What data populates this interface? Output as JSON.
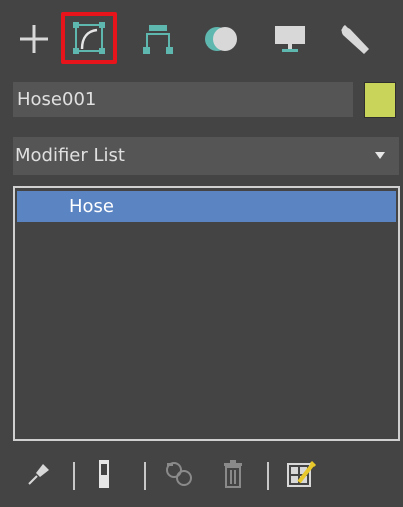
{
  "tabs": [
    {
      "id": "create",
      "icon": "plus-icon",
      "active": false
    },
    {
      "id": "modify",
      "icon": "modify-curve-icon",
      "active": true
    },
    {
      "id": "hierarchy",
      "icon": "hierarchy-icon",
      "active": false
    },
    {
      "id": "motion",
      "icon": "motion-icon",
      "active": false
    },
    {
      "id": "display",
      "icon": "display-monitor-icon",
      "active": false
    },
    {
      "id": "utilities",
      "icon": "wrench-icon",
      "active": false
    }
  ],
  "object": {
    "name": "Hose001",
    "color": "#c9d45a"
  },
  "modifier_list": {
    "label": "Modifier List"
  },
  "stack": {
    "items": [
      {
        "label": "Hose",
        "selected": true
      }
    ]
  },
  "toolbar": {
    "items": [
      "pin-stack-icon",
      "show-end-result-icon",
      "make-unique-icon",
      "remove-modifier-icon",
      "configure-modifier-sets-icon"
    ]
  },
  "colors": {
    "background": "#444444",
    "field": "#555555",
    "selection": "#5b84c3",
    "active_tab_border": "#e8141b",
    "icon_accent": "#5fb8b0"
  }
}
